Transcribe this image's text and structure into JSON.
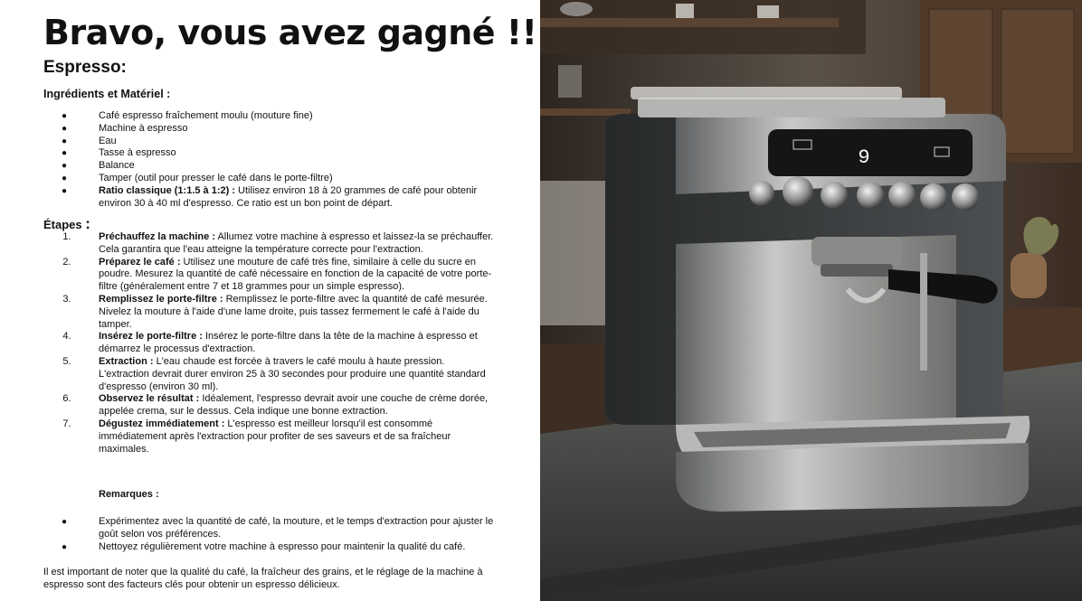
{
  "header": {
    "title": "Bravo, vous avez gagné !!!",
    "subtitle": "Espresso:"
  },
  "ingredients": {
    "heading": "Ingrédients et Matériel :",
    "items": [
      {
        "bold": "",
        "text": "Café espresso fraîchement moulu (mouture fine)"
      },
      {
        "bold": "",
        "text": "Machine à espresso"
      },
      {
        "bold": "",
        "text": "Eau"
      },
      {
        "bold": "",
        "text": "Tasse à espresso"
      },
      {
        "bold": "",
        "text": "Balance"
      },
      {
        "bold": "",
        "text": "Tamper (outil pour presser le café dans le porte-filtre)"
      },
      {
        "bold": "Ratio classique (1:1.5 à 1:2) :",
        "text": " Utilisez environ 18 à 20 grammes de café pour obtenir environ 30 à 40 ml d'espresso. Ce ratio est un bon point de départ."
      }
    ]
  },
  "steps": {
    "heading": "Étapes",
    "colon": ":",
    "items": [
      {
        "num": "1.",
        "bold": "Préchauffez la machine :",
        "text": " Allumez votre machine à espresso et laissez-la se préchauffer. Cela garantira que l'eau atteigne la température correcte pour l'extraction."
      },
      {
        "num": "2.",
        "bold": "Préparez le café :",
        "text": " Utilisez une mouture de café très fine, similaire à celle du sucre en poudre. Mesurez la quantité de café nécessaire en fonction de la capacité de votre porte-filtre (généralement entre 7 et 18 grammes pour un simple espresso)."
      },
      {
        "num": "3.",
        "bold": "Remplissez le porte-filtre :",
        "text": " Remplissez le porte-filtre avec la quantité de café mesurée. Nivelez la mouture à l'aide d'une lame droite, puis tassez fermement le café à l'aide du tamper."
      },
      {
        "num": "4.",
        "bold": "Insérez le porte-filtre :",
        "text": " Insérez le porte-filtre dans la tête de la machine à espresso et démarrez le processus d'extraction."
      },
      {
        "num": "5.",
        "bold": "Extraction :",
        "text": " L'eau chaude est forcée à travers le café moulu à haute pression. L'extraction devrait durer environ 25 à 30 secondes pour produire une quantité standard d'espresso (environ 30 ml)."
      },
      {
        "num": "6.",
        "bold": "Observez le résultat :",
        "text": " Idéalement, l'espresso devrait avoir une couche de crème dorée, appelée crema, sur le dessus. Cela indique une bonne extraction."
      },
      {
        "num": "7.",
        "bold": "Dégustez immédiatement :",
        "text": " L'espresso est meilleur lorsqu'il est consommé immédiatement après l'extraction pour profiter de ses saveurs et de sa fraîcheur maximales."
      }
    ]
  },
  "remarks": {
    "heading": "Remarques :",
    "items": [
      {
        "bold": "",
        "text": "Expérimentez avec la quantité de café, la mouture, et le temps d'extraction pour ajuster le goût selon vos préférences."
      },
      {
        "bold": "",
        "text": "Nettoyez régulièrement votre machine à espresso pour maintenir la qualité du café."
      }
    ]
  },
  "final_note": "Il est important de noter que la qualité du café, la fraîcheur des grains, et le réglage de la machine à espresso sont des facteurs clés pour obtenir un espresso délicieux.",
  "photo": {
    "display_digit": "9",
    "colors": {
      "steel": "#8c8c8c",
      "wood": "#4a3526",
      "counter": "#3a3b3a"
    }
  }
}
